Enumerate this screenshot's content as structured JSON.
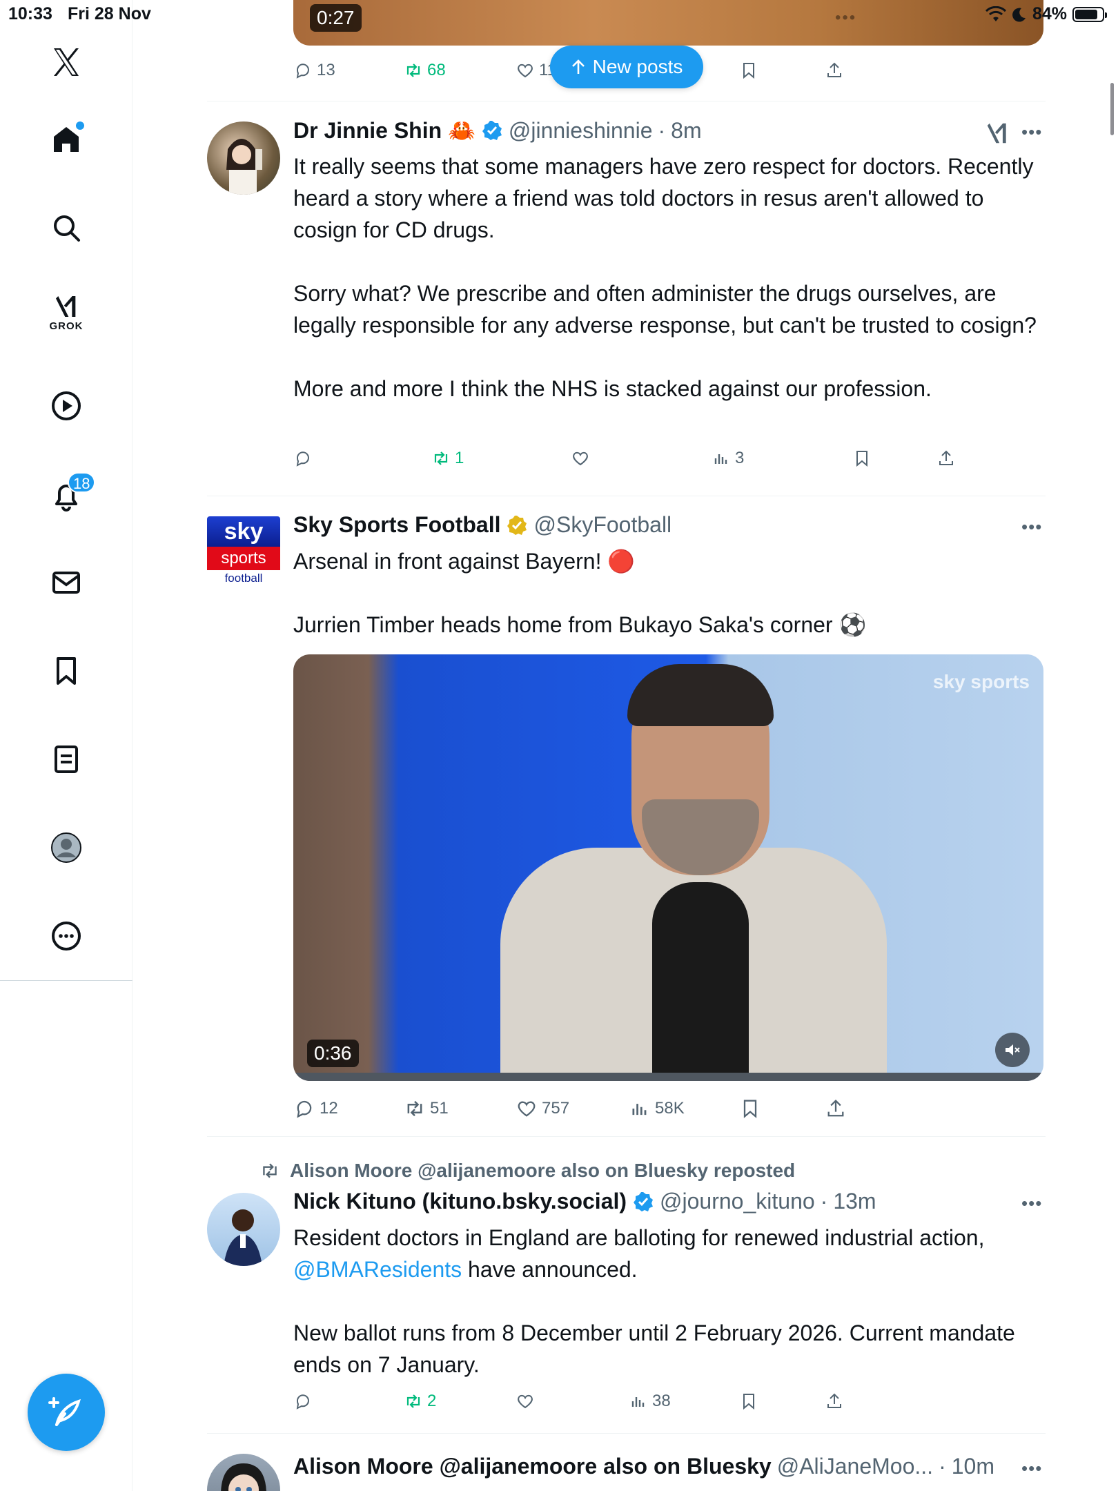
{
  "status_bar": {
    "time": "10:33",
    "date": "Fri 28 Nov",
    "battery": "84%",
    "battery_level": 0.84
  },
  "sidebar": {
    "items": [
      {
        "name": "home",
        "icon": "home-icon"
      },
      {
        "name": "explore",
        "icon": "search-icon"
      },
      {
        "name": "grok",
        "icon": "grok-icon",
        "label": "GROK"
      },
      {
        "name": "video",
        "icon": "play-icon"
      },
      {
        "name": "notifications",
        "icon": "bell-icon",
        "badge": "18"
      },
      {
        "name": "messages",
        "icon": "mail-icon"
      },
      {
        "name": "bookmarks",
        "icon": "bookmark-icon"
      },
      {
        "name": "lists",
        "icon": "list-icon"
      },
      {
        "name": "profile",
        "icon": "profile-icon"
      },
      {
        "name": "more",
        "icon": "more-icon"
      }
    ],
    "compose_icon": "compose-icon"
  },
  "top_post": {
    "video_duration": "0:27",
    "actions": {
      "replies": "13",
      "reposts": "68",
      "likes": "11"
    }
  },
  "new_posts_label": "New posts",
  "posts": [
    {
      "name": "Dr Jinnie Shin 🦀",
      "handle": "@jinnieshinnie",
      "time": "8m",
      "paragraphs": [
        "It really seems that some managers have zero respect for doctors. Recently heard a story where a friend was told doctors in resus aren't allowed to cosign for CD drugs.",
        "Sorry what? We prescribe and often administer the drugs ourselves, are legally responsible for any adverse response, but can't be trusted to cosign?",
        "More and more I think the NHS is stacked against our profession."
      ],
      "actions": {
        "replies": "",
        "reposts": "1",
        "likes": "",
        "views": "3"
      }
    },
    {
      "name": "Sky Sports Football",
      "handle": "@SkyFootball",
      "logo": {
        "sky": "sky",
        "sports": "sports",
        "football": "football"
      },
      "paragraphs": [
        "Arsenal in front against Bayern! 🔴",
        "Jurrien Timber heads home from Bukayo Saka's corner ⚽"
      ],
      "video": {
        "duration": "0:36",
        "watermark": "sky sports"
      },
      "actions": {
        "replies": "12",
        "reposts": "51",
        "likes": "757",
        "views": "58K"
      }
    },
    {
      "repost_label": "Alison Moore @alijanemoore also on Bluesky reposted",
      "name": "Nick Kituno (kituno.bsky.social)",
      "handle": "@journo_kituno",
      "time": "13m",
      "paragraph1_mention": "@BMAResidents",
      "paragraph1_before": "Resident doctors in England are balloting for renewed industrial action, ",
      "paragraph1_after": " have announced.",
      "paragraph2": "New ballot runs from 8 December until 2 February 2026. Current mandate ends on 7 January.",
      "actions": {
        "replies": "",
        "reposts": "2",
        "likes": "",
        "views": "38"
      }
    },
    {
      "name": "Alison Moore @alijanemoore also on Bluesky",
      "handle": "@AliJaneMoo...",
      "time": "10m"
    }
  ],
  "colors": {
    "accent": "#1d9bf0",
    "repost": "#00ba7c",
    "muted": "#536471",
    "verified_gold": "#e2b719"
  }
}
